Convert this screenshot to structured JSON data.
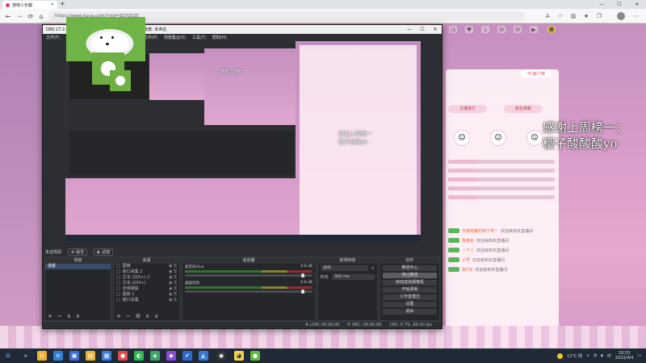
{
  "browser": {
    "tab_title": "游侠小长腿",
    "url": "https://www.huya.com/?nid=9370535",
    "new_tab": "+",
    "minimize": "—",
    "maximize": "☐",
    "close": "✕"
  },
  "web": {
    "pc_client_label": "PC客户端",
    "panel_tab_left": "主播排行",
    "panel_tab_right": "粉丝贡献",
    "chat_rows": [
      {
        "name": "不做高鹰时就下界一",
        "text": "欢迎来到本直播间"
      },
      {
        "name": "陈奥伯",
        "text": "欢迎来到本直播间"
      },
      {
        "name": "一个人",
        "text": "欢迎来到本直播间"
      },
      {
        "name": "小号",
        "text": "欢迎来到本直播间"
      },
      {
        "name": "用户8",
        "text": "欢迎来到本直播间"
      }
    ],
    "overlay_line1": "感谢上周榜一：",
    "overlay_line2": "樱子酸酸酸yo"
  },
  "obs": {
    "title": "OBS 27.2.4 (64-bit, windows) - 配置文件: 未命名 - 场景: 未命名",
    "menu": [
      "文件(F)",
      "编辑(E)",
      "视图(V)",
      "停靠窗口(D)",
      "配置文件(P)",
      "场景集合(S)",
      "工具(T)",
      "帮助(H)"
    ],
    "status_bar_label": "未选择源",
    "properties_btn": "属性",
    "filters_btn": "滤镜",
    "docks": {
      "scenes": "场景",
      "sources": "来源",
      "mixer": "混音器",
      "transitions": "转场特效",
      "controls": "控件"
    },
    "scene_items": [
      "场景"
    ],
    "source_items": [
      "图像",
      "窗口采集 2",
      "文本 (GDI+) 2",
      "文本 (GDI+)",
      "音频捕获",
      "图像 2",
      "窗口采集"
    ],
    "mixer_channels": [
      {
        "name": "麦克风/Aux",
        "db": "0.0 dB"
      },
      {
        "name": "桌面音频",
        "db": "0.0 dB"
      }
    ],
    "transition_type": "淡出",
    "duration_label": "时长",
    "duration_value": "300 ms",
    "control_buttons": [
      "推流中心",
      "停止推流",
      "启动虚拟摄像机",
      "开始录制",
      "工作室模式",
      "设置",
      "退出"
    ],
    "status": {
      "live": "LIVE: 00:00:00",
      "rec": "REC: 00:00:00",
      "cpu": "CPU: 0.7%, 60.00 fps"
    }
  },
  "taskbar": {
    "weather": "12°C 阴",
    "time": "10:53",
    "date": "2022/4/4"
  }
}
